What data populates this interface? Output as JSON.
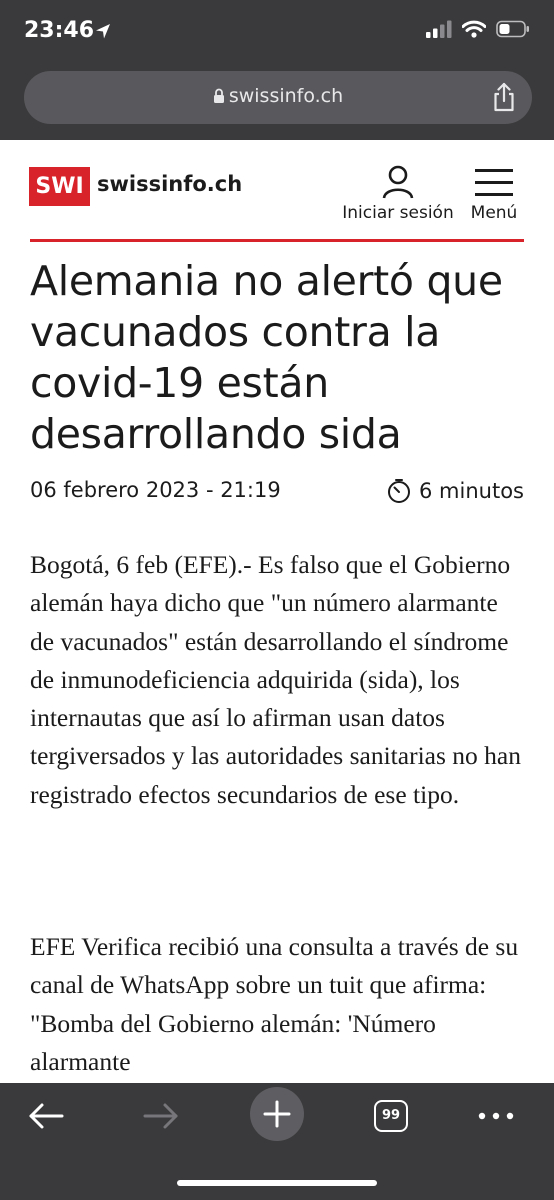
{
  "status_bar": {
    "time": "23:46"
  },
  "browser": {
    "url": "swissinfo.ch",
    "tabs_count": "99"
  },
  "site": {
    "logo_badge": "SWI",
    "logo_name": "swissinfo.ch",
    "login_label": "Iniciar sesión",
    "menu_label": "Menú",
    "brand_color": "#d8232a"
  },
  "article": {
    "title": "Alemania no alertó que vacunados contra la covid-19 están desarrollando sida",
    "date": "06 febrero 2023 - 21:19",
    "read_time": "6 minutos",
    "paragraphs": [
      "Bogotá, 6 feb (EFE).- Es falso que el Gobierno alemán haya dicho que \"un número alarmante de vacunados\" están desarrollando el síndrome de inmunodeficiencia adquirida (sida), los internautas que así lo afirman usan datos tergiversados y las autoridades sanitarias no han registrado efectos secundarios de ese tipo.",
      "EFE Verifica recibió una consulta a través de su canal de WhatsApp sobre un tuit que afirma: \"Bomba del Gobierno alemán: 'Número alarmante"
    ]
  }
}
